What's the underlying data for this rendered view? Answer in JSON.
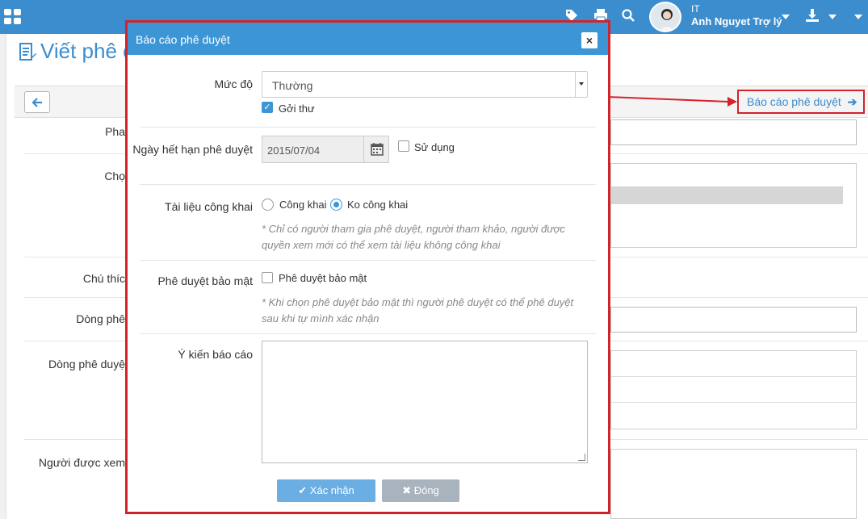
{
  "topbar": {
    "user_org": "IT",
    "user_name": "Anh Nguyet Trợ lý"
  },
  "page": {
    "title": "Viết phê c",
    "report_link": "Báo cáo phê duyệt",
    "labels": {
      "row1": "Pha",
      "row2": "Chọ",
      "row3": "Chú thíc",
      "row4": "Dòng phê",
      "row5": "Dòng phê duyệ",
      "row6": "Người được xem"
    }
  },
  "modal": {
    "title": "Báo cáo phê duyệt",
    "close_symbol": "×",
    "level_label": "Mức độ",
    "level_value": "Thường",
    "send_mail_label": "Gởi thư",
    "expiry_label": "Ngày hết hạn phê duyệt",
    "expiry_value": "2015/07/04",
    "use_label": "Sử dụng",
    "public_doc_label": "Tài liệu công khai",
    "public_option": "Công khai",
    "private_option": "Ko công khai",
    "public_note": "* Chỉ có người tham gia phê duyệt, người tham khảo, người được quyền xem mới có thể xem tài liệu không công khai",
    "secure_label": "Phê duyệt bảo mật",
    "secure_checkbox_label": "Phê duyệt bảo mật",
    "secure_note": "* Khi chọn phê duyệt bảo mật thì người phê duyệt có thể phê duyệt sau khi tự mình xác nhận",
    "opinion_label": "Ý kiến báo cáo",
    "confirm_button": "Xác nhận",
    "close_button": "Đóng"
  },
  "colors": {
    "brand": "#3c8dce",
    "highlight": "#d2232a"
  }
}
